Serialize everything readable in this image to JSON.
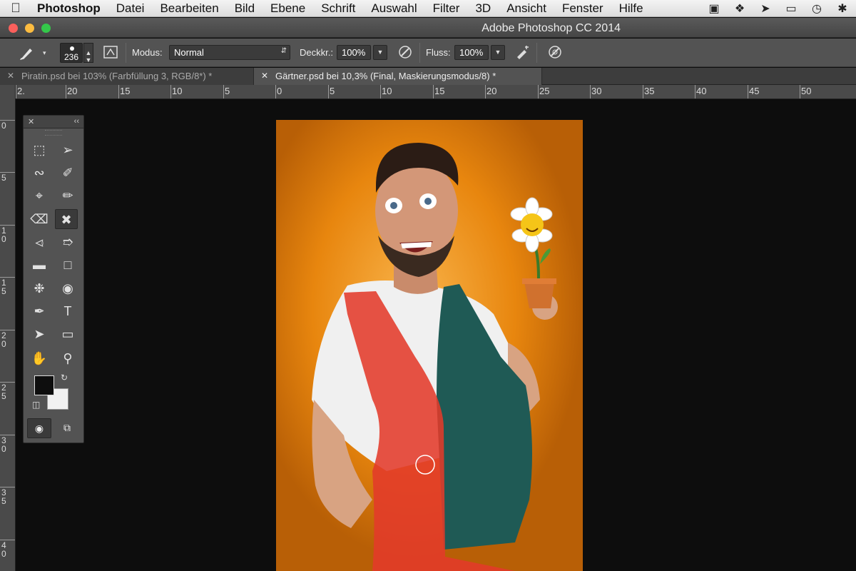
{
  "menubar": {
    "app_name": "Photoshop",
    "items": [
      "Datei",
      "Bearbeiten",
      "Bild",
      "Ebene",
      "Schrift",
      "Auswahl",
      "Filter",
      "3D",
      "Ansicht",
      "Fenster",
      "Hilfe"
    ],
    "tray_icons": [
      "display-icon",
      "dropbox-icon",
      "hub-icon",
      "airplay-icon",
      "time-machine-icon",
      "bluetooth-icon"
    ]
  },
  "window": {
    "title": "Adobe Photoshop CC 2014"
  },
  "options": {
    "brush_size": "236",
    "mode_label": "Modus:",
    "mode_value": "Normal",
    "opacity_label": "Deckkr.:",
    "opacity_value": "100%",
    "flow_label": "Fluss:",
    "flow_value": "100%"
  },
  "tabs": [
    {
      "title": "Piratin.psd bei 103% (Farbfüllung 3, RGB/8*) *",
      "active": false
    },
    {
      "title": "Gärtner.psd bei 10,3% (Final, Maskierungsmodus/8) *",
      "active": true
    }
  ],
  "ruler_h": [
    "2.",
    "20",
    "15",
    "10",
    "5",
    "0",
    "5",
    "10",
    "15",
    "20",
    "25",
    "30",
    "35",
    "40",
    "45",
    "50"
  ],
  "ruler_v": [
    "0",
    "5",
    "10",
    "15",
    "20",
    "25",
    "30",
    "35",
    "40"
  ],
  "colors": {
    "foreground": "#0e0e0e",
    "background": "#f1f1f1",
    "mask_overlay": "#e23a2a",
    "canvas_orange": "#e8860e"
  },
  "tools": [
    "rectangle-marquee-icon",
    "move-icon",
    "lasso-icon",
    "quick-selection-icon",
    "crop-icon",
    "eyedropper-icon",
    "healing-brush-icon",
    "brush-icon",
    "clone-stamp-icon",
    "history-brush-icon",
    "eraser-icon",
    "gradient-icon",
    "blur-icon",
    "dodge-icon",
    "pen-icon",
    "type-icon",
    "path-selection-icon",
    "shape-icon",
    "hand-icon",
    "zoom-icon"
  ]
}
